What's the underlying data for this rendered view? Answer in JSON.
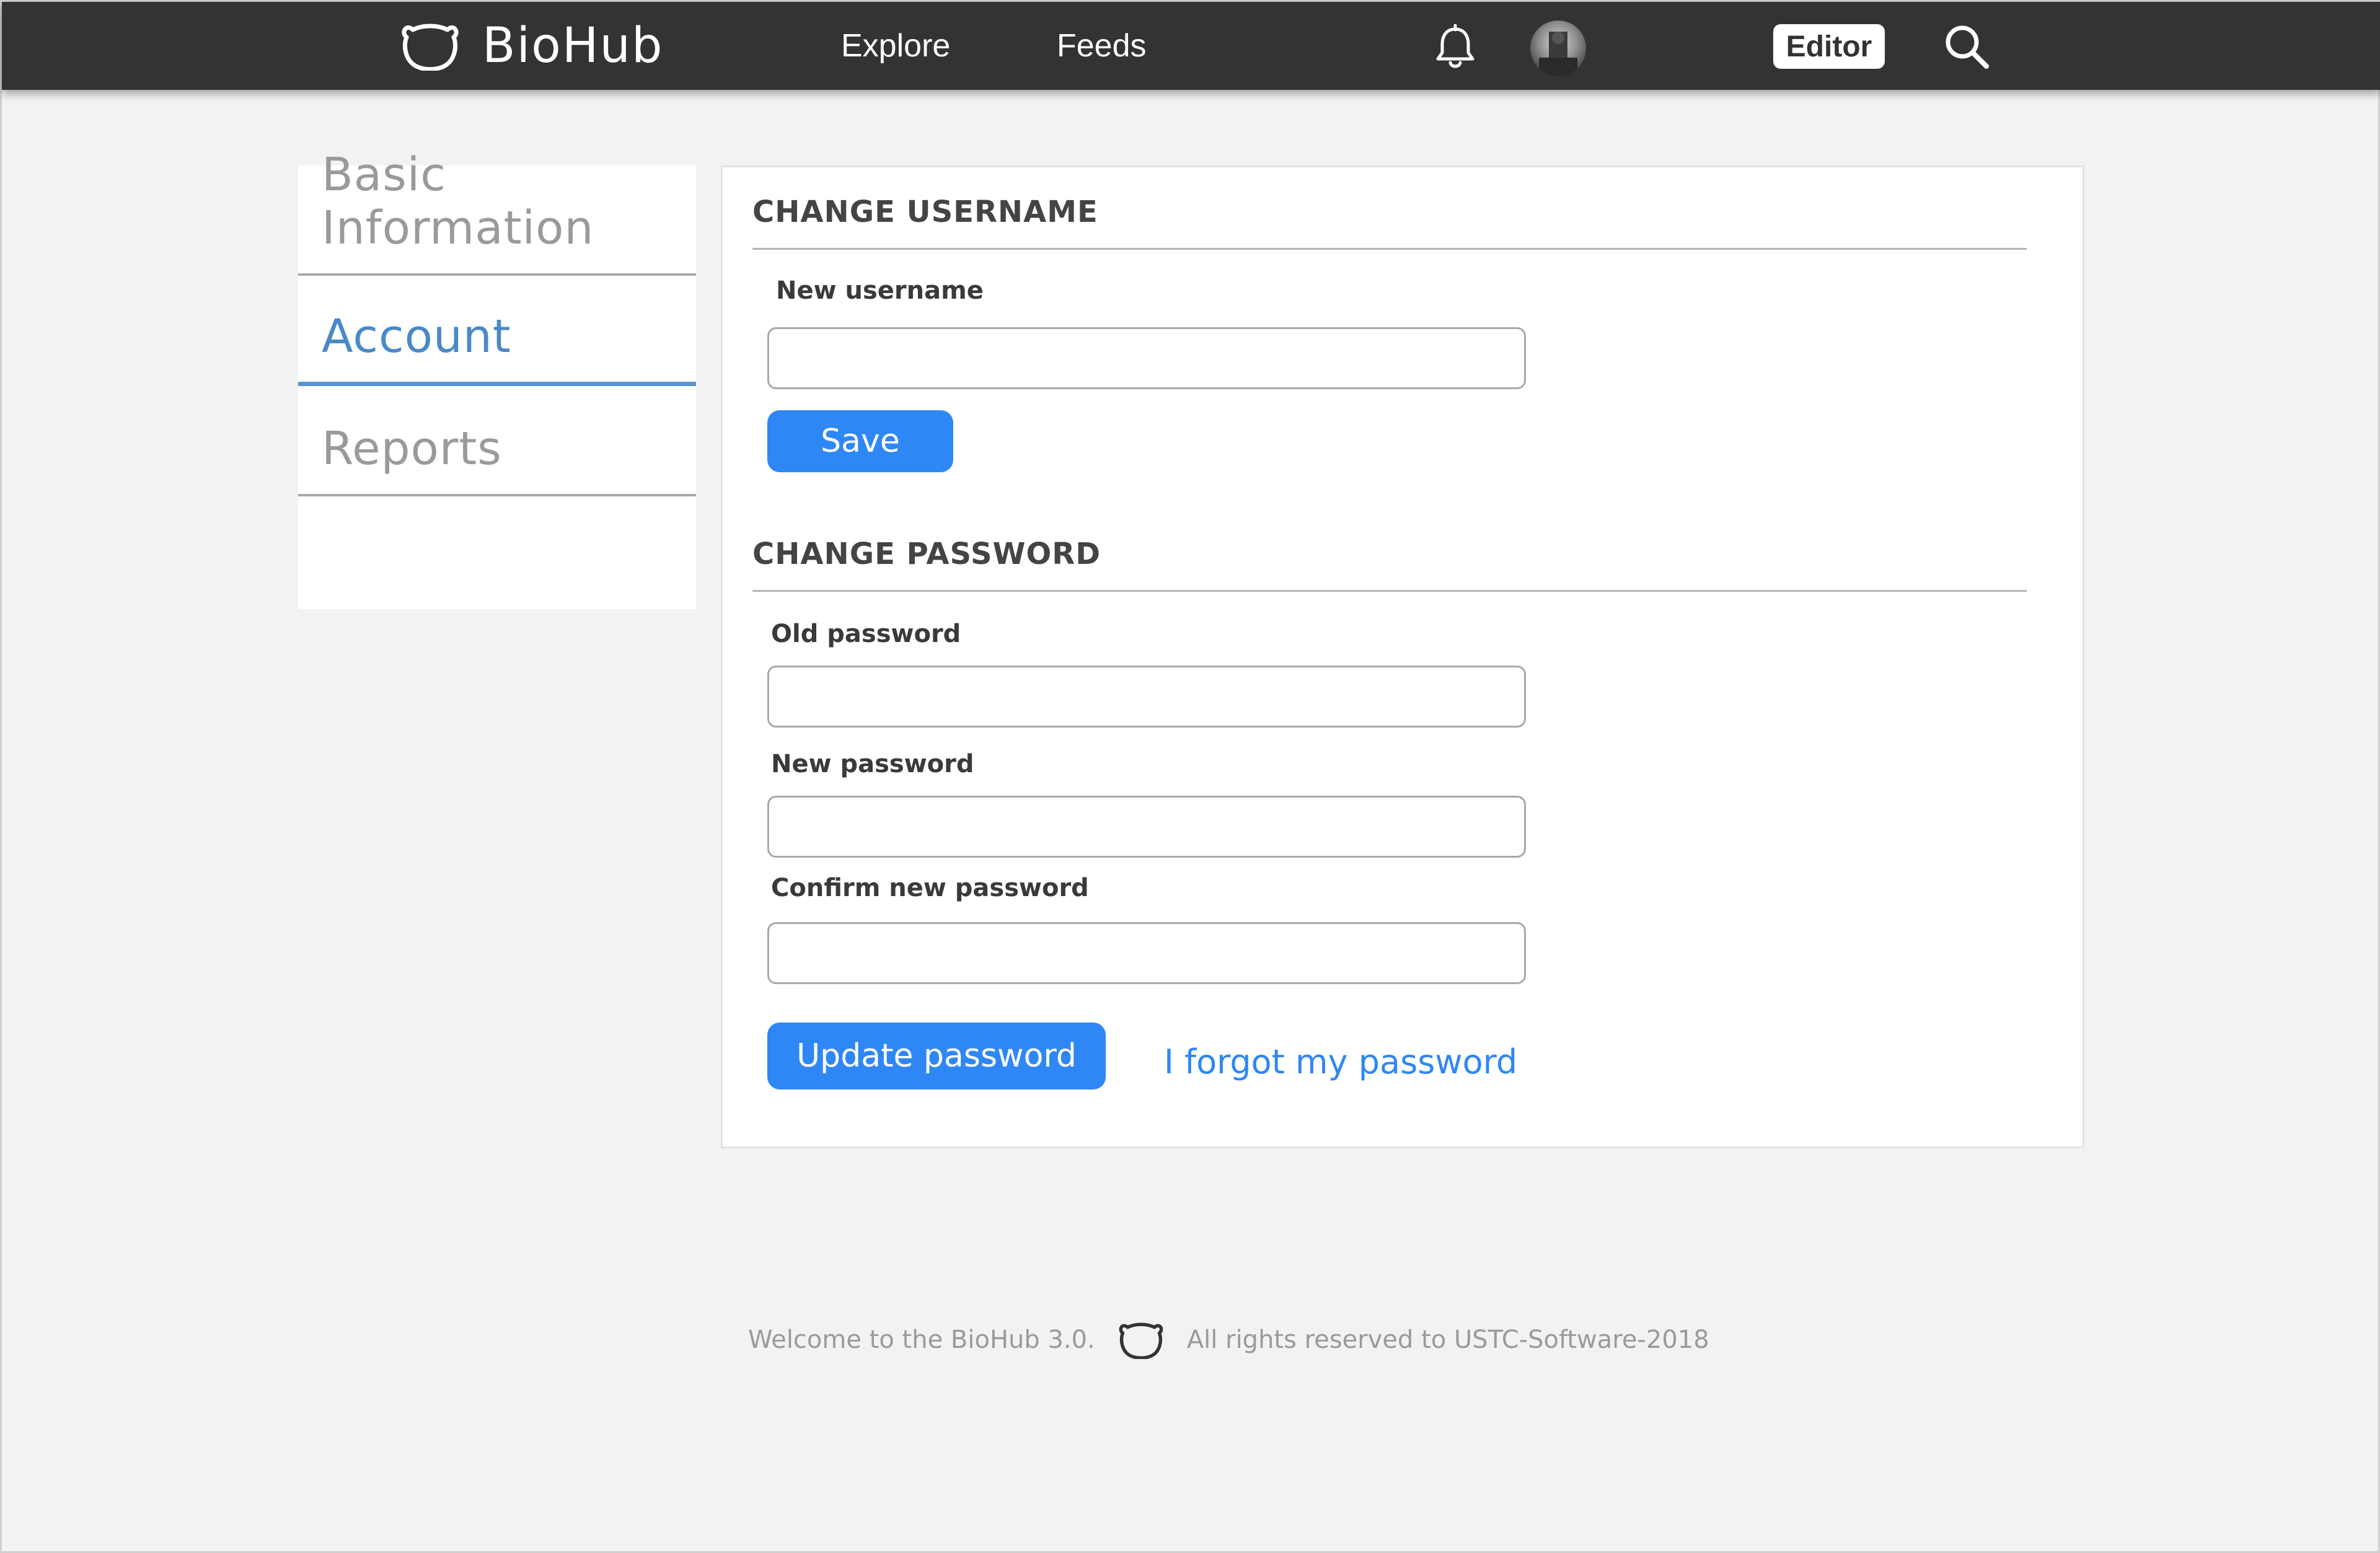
{
  "header": {
    "brand_name": "BioHub",
    "logo_icon": "bear-head-icon",
    "nav": [
      {
        "label": "Explore"
      },
      {
        "label": "Feeds"
      }
    ],
    "notifications_icon": "bell-icon",
    "avatar": "user-avatar",
    "editor_label": "Editor",
    "search_icon": "search-icon",
    "background_color": "#333333"
  },
  "sidebar": {
    "items": [
      {
        "label": "Basic Information",
        "active": false
      },
      {
        "label": "Account",
        "active": true
      },
      {
        "label": "Reports",
        "active": false
      }
    ],
    "active_color": "#4a89c8"
  },
  "main": {
    "change_username": {
      "title": "CHANGE USERNAME",
      "new_username_label": "New username",
      "new_username_value": "",
      "save_label": "Save"
    },
    "change_password": {
      "title": "CHANGE PASSWORD",
      "old_password_label": "Old password",
      "old_password_value": "",
      "new_password_label": "New password",
      "new_password_value": "",
      "confirm_password_label": "Confirm new password",
      "confirm_password_value": "",
      "update_label": "Update password",
      "forgot_label": "I forgot my password"
    },
    "accent_color": "#2f87f5"
  },
  "footer": {
    "welcome_text": "Welcome to the BioHub 3.0.",
    "rights_text": "All rights reserved to USTC-Software-2018",
    "logo_icon": "bear-head-icon"
  }
}
